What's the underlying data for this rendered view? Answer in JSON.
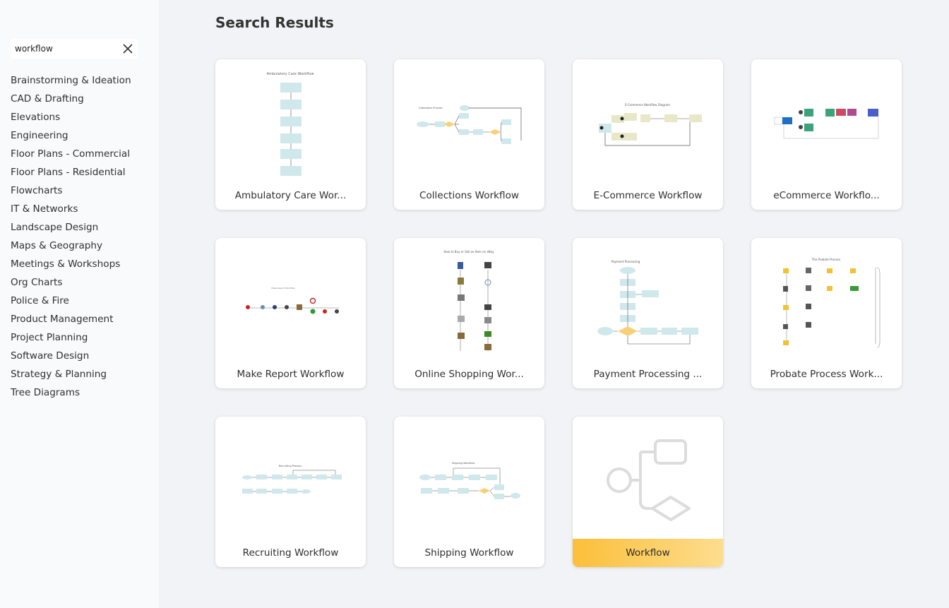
{
  "search": {
    "value": "workflow",
    "clear_icon": "close-icon"
  },
  "sidebar": {
    "items": [
      "Brainstorming & Ideation",
      "CAD & Drafting",
      "Elevations",
      "Engineering",
      "Floor Plans - Commercial",
      "Floor Plans - Residential",
      "Flowcharts",
      "IT & Networks",
      "Landscape Design",
      "Maps & Geography",
      "Meetings & Workshops",
      "Org Charts",
      "Police & Fire",
      "Product Management",
      "Project Planning",
      "Software Design",
      "Strategy & Planning",
      "Tree Diagrams"
    ]
  },
  "main": {
    "title": "Search Results",
    "cards": [
      {
        "label": "Ambulatory Care Wor...",
        "thumb_title": "Ambulatory Care Workflow"
      },
      {
        "label": "Collections Workflow",
        "thumb_title": "Collections Process"
      },
      {
        "label": "E-Commerce Workflow",
        "thumb_title": "E-Commerce Workflow Diagram"
      },
      {
        "label": "eCommerce Workflo...",
        "thumb_title": ""
      },
      {
        "label": "Make Report Workflow",
        "thumb_title": "Make Report Workflow"
      },
      {
        "label": "Online Shopping Wor...",
        "thumb_title": "How to Buy or Sell an Item on eBay"
      },
      {
        "label": "Payment Processing ...",
        "thumb_title": "Payment Processing"
      },
      {
        "label": "Probate Process Work...",
        "thumb_title": "The Probate Process"
      },
      {
        "label": "Recruiting Workflow",
        "thumb_title": "Recruiting Process"
      },
      {
        "label": "Shipping Workflow",
        "thumb_title": "Shipping Workflow"
      },
      {
        "label": "Workflow",
        "thumb_title": ""
      }
    ]
  },
  "colors": {
    "accent_gradient_start": "#fbbf3a",
    "accent_gradient_end": "#fddd8e",
    "node_fill": "#cfe8ec",
    "decision_fill": "#f9d07a"
  }
}
